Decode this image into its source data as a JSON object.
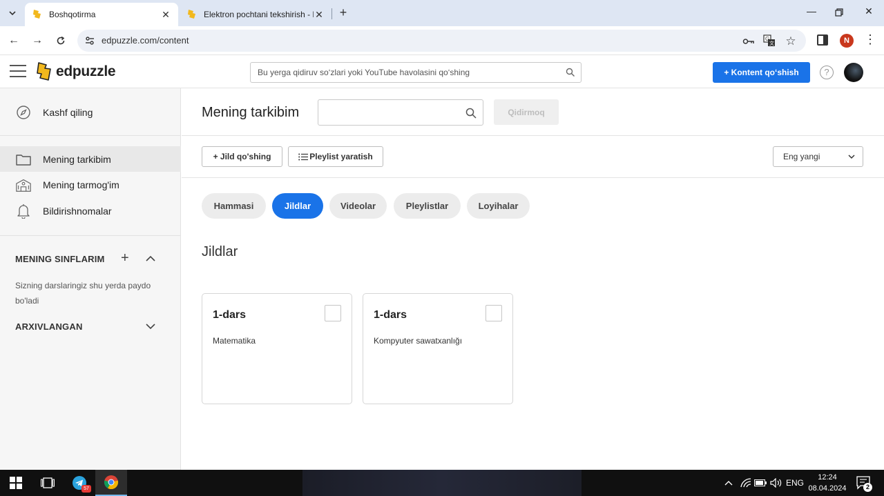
{
  "browser": {
    "tabs": [
      {
        "title": "Boshqotirma",
        "active": true
      },
      {
        "title": "Elektron pochtani tekshirish - Ed",
        "active": false
      }
    ],
    "url": "edpuzzle.com/content"
  },
  "header": {
    "logo_text": "edpuzzle",
    "search_placeholder": "Bu yerga qidiruv so‘zlari yoki YouTube havolasini qo‘shing",
    "add_content_label": "+ Kontent qo‘shish",
    "help_label": "?"
  },
  "sidebar": {
    "discover_label": "Kashf qiling",
    "items": [
      {
        "label": "Mening tarkibim",
        "icon": "folder-icon",
        "active": true
      },
      {
        "label": "Mening tarmog'im",
        "icon": "school-icon",
        "active": false
      },
      {
        "label": "Bildirishnomalar",
        "icon": "bell-icon",
        "active": false
      }
    ],
    "classes_title": "MENING SINFLARIM",
    "classes_note": "Sizning darslaringiz shu yerda paydo bo'ladi",
    "archived_title": "ARXIVLANGAN"
  },
  "main": {
    "title": "Mening tarkibim",
    "search_value": "",
    "search_button": "Qidirmoq",
    "add_folder_label": "+ Jild qo'shing",
    "create_playlist_label": "Pleylist yaratish",
    "sort_value": "Eng yangi",
    "filters": [
      {
        "label": "Hammasi",
        "active": false
      },
      {
        "label": "Jildlar",
        "active": true
      },
      {
        "label": "Videolar",
        "active": false
      },
      {
        "label": "Pleylistlar",
        "active": false
      },
      {
        "label": "Loyihalar",
        "active": false
      }
    ],
    "section_title": "Jildlar",
    "folders": [
      {
        "name": "1-dars",
        "class": "Matematika"
      },
      {
        "name": "1-dars",
        "class": "Kompyuter sawatxanlığı"
      }
    ]
  },
  "taskbar": {
    "telegram_badge": "57",
    "language": "ENG",
    "time": "12:24",
    "date": "08.04.2024",
    "notification_count": "2"
  },
  "colors": {
    "accent": "#1a73e8",
    "logo_yellow": "#f2b81d",
    "tab_strip": "#dee6f3"
  }
}
